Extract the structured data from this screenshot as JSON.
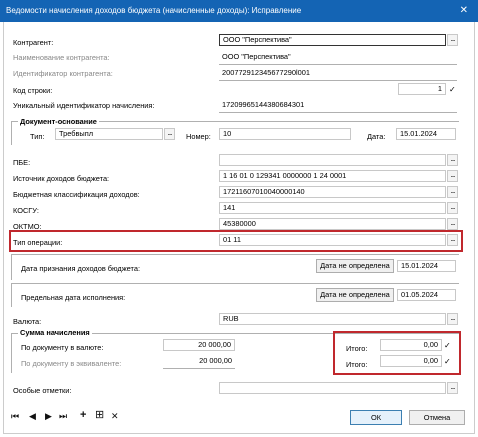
{
  "window": {
    "title": "Ведомости начисления доходов бюджета (начисленные доходы): Исправление",
    "close_glyph": "✕"
  },
  "form": {
    "kontragent": {
      "label": "Контрагент:",
      "value": "ООО \"Перспектива\""
    },
    "naim_kontragenta": {
      "label": "Наименование контрагента:",
      "value": "ООО \"Перспектива\""
    },
    "id_kontragenta": {
      "label": "Идентификатор контрагента:",
      "value": "200772912345677290l001"
    },
    "kod_stroki": {
      "label": "Код строки:",
      "value": "1"
    },
    "uin": {
      "label": "Уникальный идентификатор начисления:",
      "value": "17209965144380684301"
    },
    "dokument_osnovanie": {
      "group_label": "Документ-основание",
      "tip_label": "Тип:",
      "tip_value": "Требвыпл",
      "nomer_label": "Номер:",
      "nomer_value": "10",
      "data_label": "Дата:",
      "data_value": "15.01.2024"
    },
    "pbe": {
      "label": "ПБЕ:",
      "value": ""
    },
    "istochnik": {
      "label": "Источник доходов бюджета:",
      "value": "1 16 01 0 129341 0000000 1 24 0001"
    },
    "bk_dohodov": {
      "label": "Бюджетная классификация доходов:",
      "value": "17211607010040000140"
    },
    "kosgu": {
      "label": "КОСГУ:",
      "value": "141"
    },
    "oktmo": {
      "label": "ОКТМО:",
      "value": "45380000"
    },
    "tip_operacii": {
      "label": "Тип операции:",
      "value": "01 11"
    },
    "data_priznaniya": {
      "label": "Дата признания доходов бюджета:",
      "button": "Дата не определена",
      "value": "15.01.2024"
    },
    "predelnaya_data": {
      "label": "Предельная дата исполнения:",
      "button": "Дата не определена",
      "value": "01.05.2024"
    },
    "valyuta": {
      "label": "Валюта:",
      "value": "RUB"
    },
    "summa": {
      "group_label": "Сумма начисления",
      "po_dok_valute_label": "По документу в валюте:",
      "po_dok_valute_value": "20 000,00",
      "po_dok_ekv_label": "По документу в эквиваленте:",
      "po_dok_ekv_value": "20 000,00",
      "itogo1_label": "Итого:",
      "itogo1_value": "0,00",
      "itogo2_label": "Итого:",
      "itogo2_value": "0,00"
    },
    "osobye_otmetki": {
      "label": "Особые отметки:",
      "value": ""
    }
  },
  "buttons": {
    "dots": "...",
    "check": "✓",
    "ok": "ОК",
    "cancel": "Отмена"
  },
  "nav": {
    "first": "⏮",
    "prev": "◀",
    "next": "▶",
    "last": "⏭",
    "add": "+",
    "add_copy": "⊞",
    "delete": "✕"
  },
  "colors": {
    "titlebar": "#1464b4",
    "highlight_red": "#c0282d"
  }
}
